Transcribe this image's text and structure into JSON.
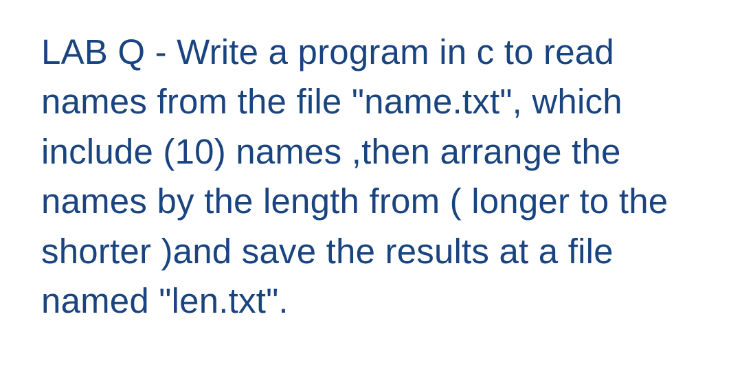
{
  "question": {
    "text": "LAB Q - Write a program in c to read names from the file \"name.txt\", which include (10) names ,then arrange the names by the length from ( longer to the shorter )and save the results at a file named \"len.txt\"."
  }
}
